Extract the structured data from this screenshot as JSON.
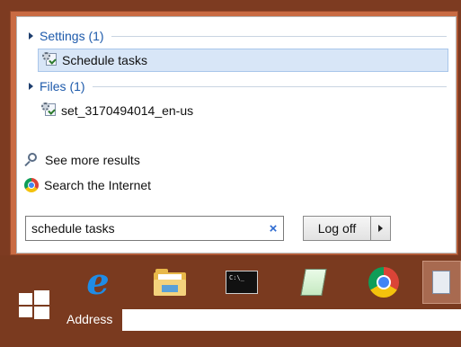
{
  "start_menu": {
    "groups": [
      {
        "label": "Settings (1)",
        "items": [
          {
            "label": "Schedule tasks",
            "selected": true
          }
        ]
      },
      {
        "label": "Files (1)",
        "items": [
          {
            "label": "set_3170494014_en-us",
            "selected": false
          }
        ]
      }
    ],
    "see_more": "See more results",
    "search_internet": "Search the Internet",
    "search": {
      "value": "schedule tasks",
      "clear_glyph": "×"
    },
    "power": {
      "label": "Log off"
    }
  },
  "taskbar": {
    "icons": [
      "internet-explorer-icon",
      "file-explorer-icon",
      "command-prompt-icon",
      "notepad-icon",
      "chrome-icon",
      "schedule-tasks-icon"
    ],
    "address_label": "Address",
    "address_value": ""
  },
  "colors": {
    "accent": "#1d5aab",
    "taskbar": "#7a3a1f",
    "selection": "#d8e6f7"
  }
}
